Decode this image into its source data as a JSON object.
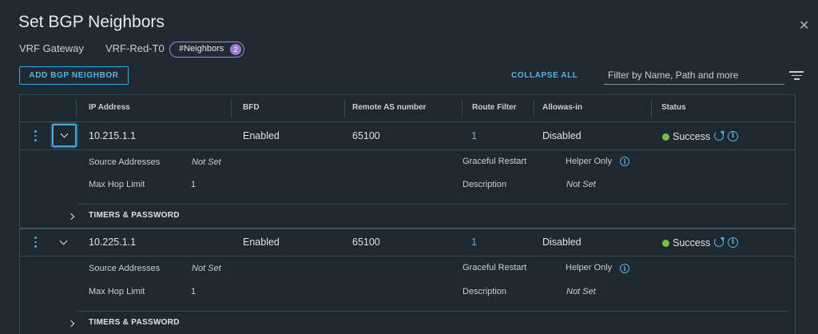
{
  "dialog": {
    "title": "Set BGP Neighbors",
    "close": "✕"
  },
  "meta": {
    "gateway_label": "VRF Gateway",
    "gateway_value": "VRF-Red-T0",
    "neighbors_pill": "#Neighbors",
    "neighbors_count": "2"
  },
  "toolbar": {
    "add_label": "ADD BGP NEIGHBOR",
    "collapse_label": "COLLAPSE ALL",
    "filter_placeholder": "Filter by Name, Path and more"
  },
  "columns": [
    "IP Address",
    "BFD",
    "Remote AS number",
    "Route Filter",
    "Allowas-in",
    "Status"
  ],
  "rows": [
    {
      "ip": "10.215.1.1",
      "bfd": "Enabled",
      "remote_as": "65100",
      "route_filter": "1",
      "allowas_in": "Disabled",
      "status": "Success",
      "source_addresses_label": "Source Addresses",
      "source_addresses": "Not Set",
      "graceful_restart_label": "Graceful Restart",
      "graceful_restart": "Helper Only",
      "max_hop_label": "Max Hop Limit",
      "max_hop": "1",
      "description_label": "Description",
      "description": "Not Set",
      "timers_label": "TIMERS & PASSWORD"
    },
    {
      "ip": "10.225.1.1",
      "bfd": "Enabled",
      "remote_as": "65100",
      "route_filter": "1",
      "allowas_in": "Disabled",
      "status": "Success",
      "source_addresses_label": "Source Addresses",
      "source_addresses": "Not Set",
      "graceful_restart_label": "Graceful Restart",
      "graceful_restart": "Helper Only",
      "max_hop_label": "Max Hop Limit",
      "max_hop": "1",
      "description_label": "Description",
      "description": "Not Set",
      "timers_label": "TIMERS & PASSWORD"
    }
  ],
  "colors": {
    "background": "#1f2a33",
    "accent": "#5cb3e3",
    "success": "#7ac143",
    "pill_border": "#a58ad6"
  },
  "icons": [
    "close-icon",
    "filter-icon",
    "row-actions-icon",
    "chevron-down-icon",
    "chevron-right-icon",
    "status-success-icon",
    "refresh-icon",
    "info-icon"
  ]
}
